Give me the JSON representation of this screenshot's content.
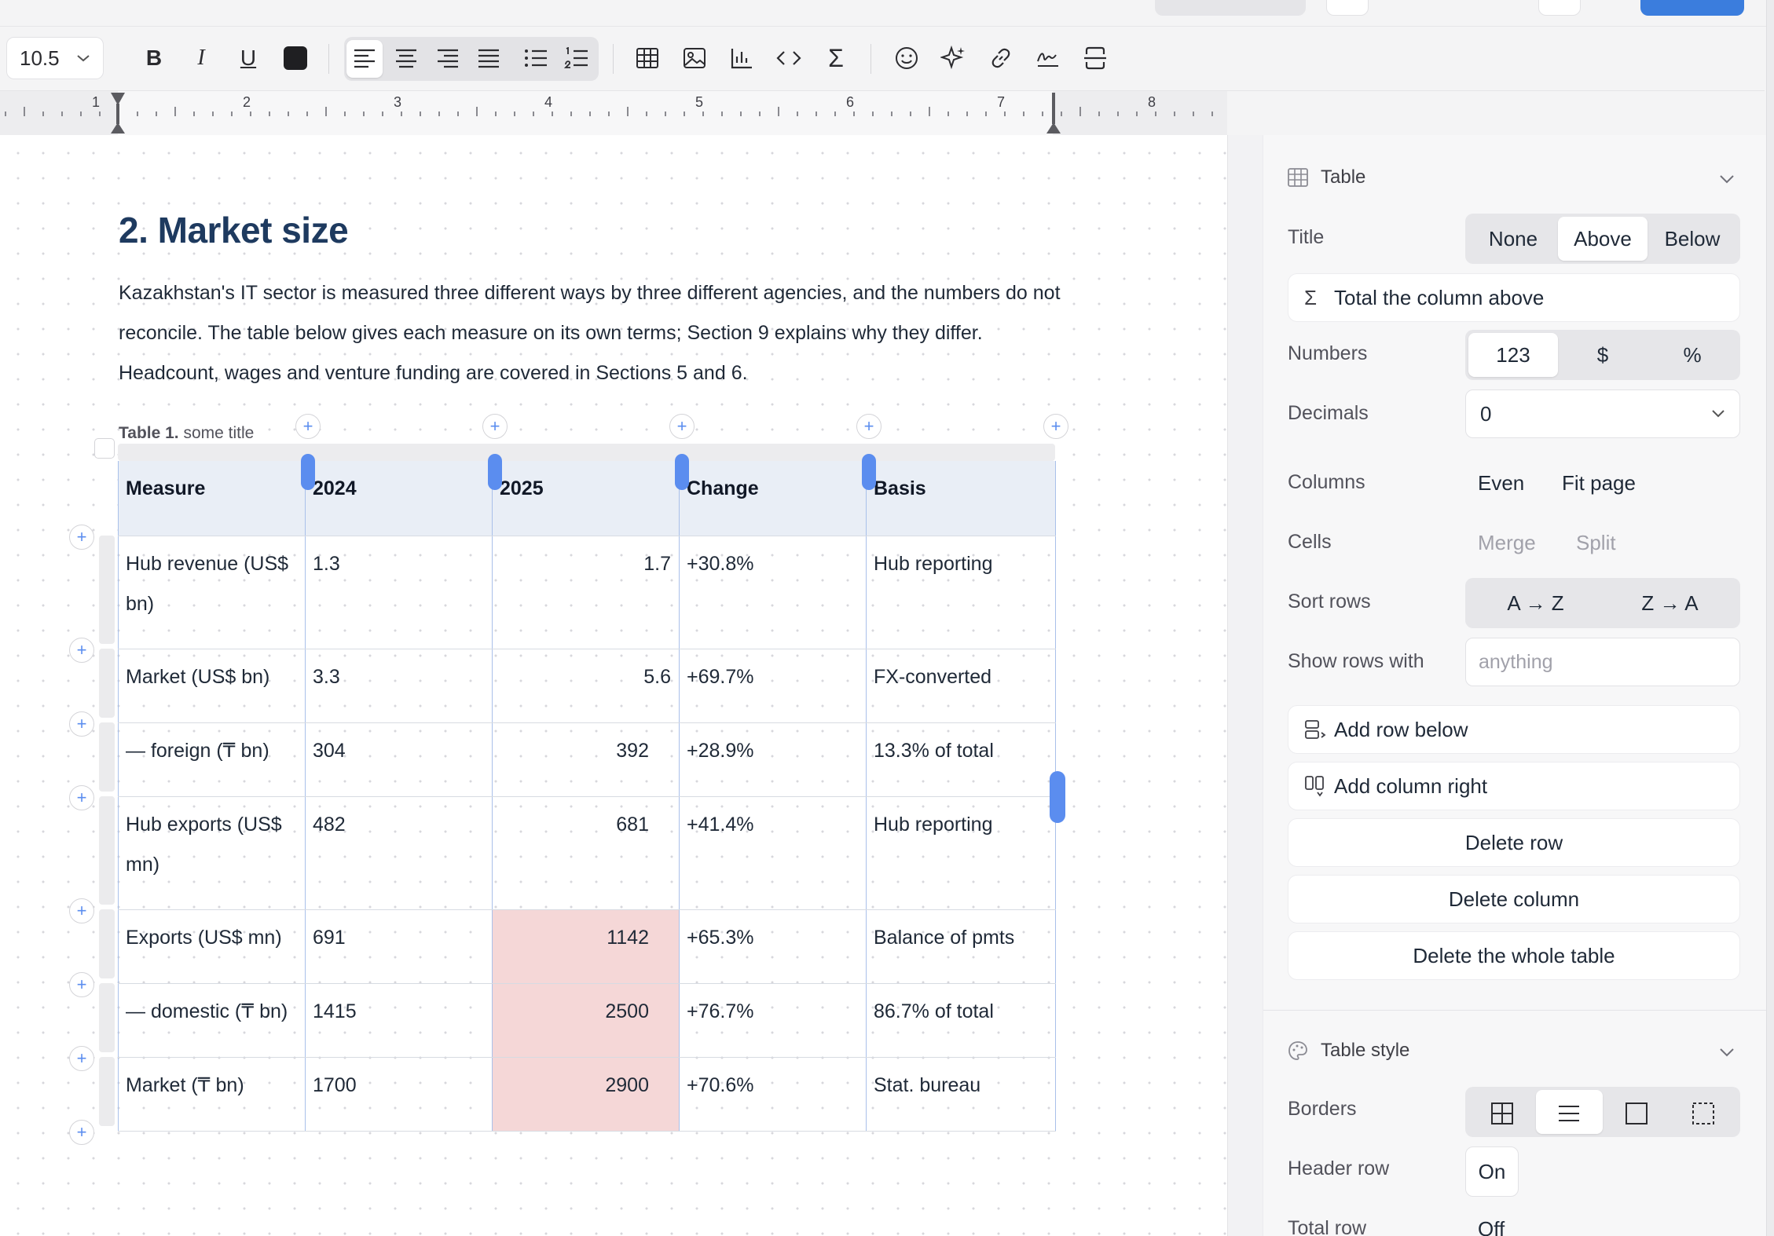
{
  "toolbar": {
    "font_size": "10.5",
    "bold_icon": "B",
    "italic_icon": "I",
    "underline_icon": "U"
  },
  "ruler": {
    "numbers": [
      "1",
      "2",
      "3",
      "4",
      "5",
      "6",
      "7",
      "8"
    ]
  },
  "document": {
    "heading": "2. Market size",
    "paragraph": "Kazakhstan's IT sector is measured three different ways by three different agencies, and the numbers do not reconcile. The table below gives each measure on its own terms; Section 9 explains why they differ. Headcount, wages and venture funding are covered in Sections 5 and 6.",
    "caption_label": "Table 1.",
    "caption_text": "some title",
    "table": {
      "headers": [
        "Measure",
        "2024",
        "2025",
        "Change",
        "Basis"
      ],
      "rows": [
        [
          "Hub revenue (US$ bn)",
          "1.3",
          "1.7",
          "+30.8%",
          "Hub reporting"
        ],
        [
          "Market (US$ bn)",
          "3.3",
          "5.6",
          "+69.7%",
          "FX-converted"
        ],
        [
          "— foreign (₸ bn)",
          "304",
          "392",
          "+28.9%",
          "13.3% of total"
        ],
        [
          "Hub exports (US$ mn)",
          "482",
          "681",
          "+41.4%",
          "Hub reporting"
        ],
        [
          "Exports (US$ mn)",
          "691",
          "1142",
          "+65.3%",
          "Balance of pmts"
        ],
        [
          "— domestic (₸ bn)",
          "1415",
          "2500",
          "+76.7%",
          "86.7% of total"
        ],
        [
          "Market (₸ bn)",
          "1700",
          "2900",
          "+70.6%",
          "Stat. bureau"
        ]
      ]
    }
  },
  "sidebar": {
    "table_section": "Table",
    "title_label": "Title",
    "title_options": [
      "None",
      "Above",
      "Below"
    ],
    "title_selected": "Above",
    "total_button": "Total the column above",
    "numbers_label": "Numbers",
    "numbers_options": [
      "123",
      "$",
      "%"
    ],
    "numbers_selected": "123",
    "decimals_label": "Decimals",
    "decimals_value": "0",
    "columns_label": "Columns",
    "columns_even": "Even",
    "columns_fit": "Fit page",
    "cells_label": "Cells",
    "cells_merge": "Merge",
    "cells_split": "Split",
    "sort_label": "Sort rows",
    "sort_az": "A → Z",
    "sort_za": "Z → A",
    "show_rows_label": "Show rows with",
    "show_rows_placeholder": "anything",
    "add_row": "Add row below",
    "add_column": "Add column right",
    "delete_row": "Delete row",
    "delete_column": "Delete column",
    "delete_table": "Delete the whole table",
    "style_section": "Table style",
    "borders_label": "Borders",
    "header_row_label": "Header row",
    "header_row_value": "On",
    "total_row_label": "Total row",
    "total_row_value": "Off"
  },
  "colors": {
    "accent": "#5b8def",
    "heading": "#1e3a5f",
    "header_fill": "#e9eef6",
    "highlight_fill": "#f5d7d7"
  }
}
